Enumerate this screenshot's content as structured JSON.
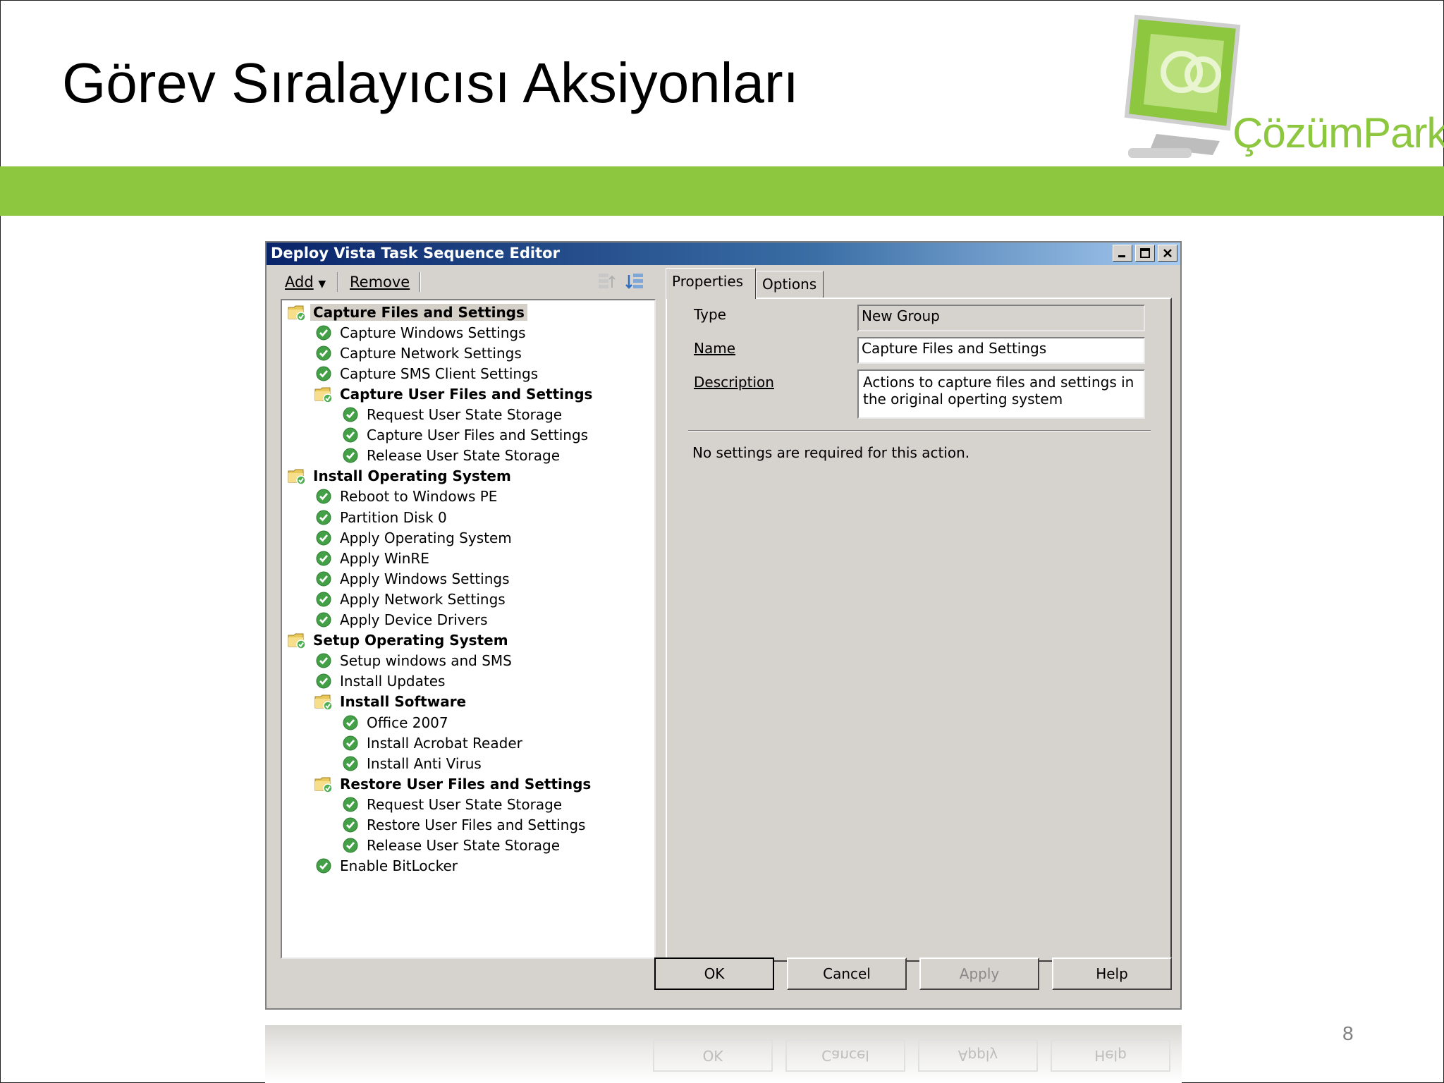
{
  "slide": {
    "title": "Görev Sıralayıcısı Aksiyonları",
    "logo_text": "ÇözümPark",
    "page_number": "8",
    "accent_color": "#8dc63f"
  },
  "window": {
    "title": "Deploy Vista Task Sequence Editor",
    "toolbar": {
      "add_label": "Add",
      "remove_label": "Remove"
    },
    "tree": [
      {
        "label": "Capture Files and Settings",
        "type": "group",
        "level": 0,
        "selected": true
      },
      {
        "label": "Capture Windows Settings",
        "type": "step",
        "level": 1
      },
      {
        "label": "Capture Network Settings",
        "type": "step",
        "level": 1
      },
      {
        "label": "Capture SMS Client Settings",
        "type": "step",
        "level": 1
      },
      {
        "label": "Capture User Files and Settings",
        "type": "group",
        "level": 1
      },
      {
        "label": "Request User State Storage",
        "type": "step",
        "level": 2
      },
      {
        "label": "Capture User Files and Settings",
        "type": "step",
        "level": 2
      },
      {
        "label": "Release User State Storage",
        "type": "step",
        "level": 2
      },
      {
        "label": "Install Operating System",
        "type": "group",
        "level": 0
      },
      {
        "label": "Reboot to Windows PE",
        "type": "step",
        "level": 1
      },
      {
        "label": "Partition Disk 0",
        "type": "step",
        "level": 1
      },
      {
        "label": "Apply Operating System",
        "type": "step",
        "level": 1
      },
      {
        "label": "Apply WinRE",
        "type": "step",
        "level": 1
      },
      {
        "label": "Apply Windows Settings",
        "type": "step",
        "level": 1
      },
      {
        "label": "Apply Network Settings",
        "type": "step",
        "level": 1
      },
      {
        "label": "Apply Device Drivers",
        "type": "step",
        "level": 1
      },
      {
        "label": "Setup Operating System",
        "type": "group",
        "level": 0
      },
      {
        "label": "Setup windows and SMS",
        "type": "step",
        "level": 1
      },
      {
        "label": "Install Updates",
        "type": "step",
        "level": 1
      },
      {
        "label": "Install Software",
        "type": "group",
        "level": 1
      },
      {
        "label": "Office 2007",
        "type": "step",
        "level": 2
      },
      {
        "label": "Install Acrobat Reader",
        "type": "step",
        "level": 2
      },
      {
        "label": "Install Anti Virus",
        "type": "step",
        "level": 2
      },
      {
        "label": "Restore User Files and Settings",
        "type": "group",
        "level": 1
      },
      {
        "label": "Request User State Storage",
        "type": "step",
        "level": 2
      },
      {
        "label": "Restore User Files and Settings",
        "type": "step",
        "level": 2
      },
      {
        "label": "Release User State Storage",
        "type": "step",
        "level": 2
      },
      {
        "label": "Enable BitLocker",
        "type": "step",
        "level": 1
      }
    ],
    "tabs": [
      {
        "label": "Properties",
        "active": true
      },
      {
        "label": "Options",
        "active": false
      }
    ],
    "properties": {
      "type_label": "Type",
      "type_value": "New Group",
      "name_label": "Name",
      "name_value": "Capture Files and Settings",
      "description_label": "Description",
      "description_value": "Actions to capture files and settings in the original operting system",
      "info": "No settings are required  for this action."
    },
    "buttons": {
      "ok": "OK",
      "cancel": "Cancel",
      "apply": "Apply",
      "help": "Help"
    }
  }
}
